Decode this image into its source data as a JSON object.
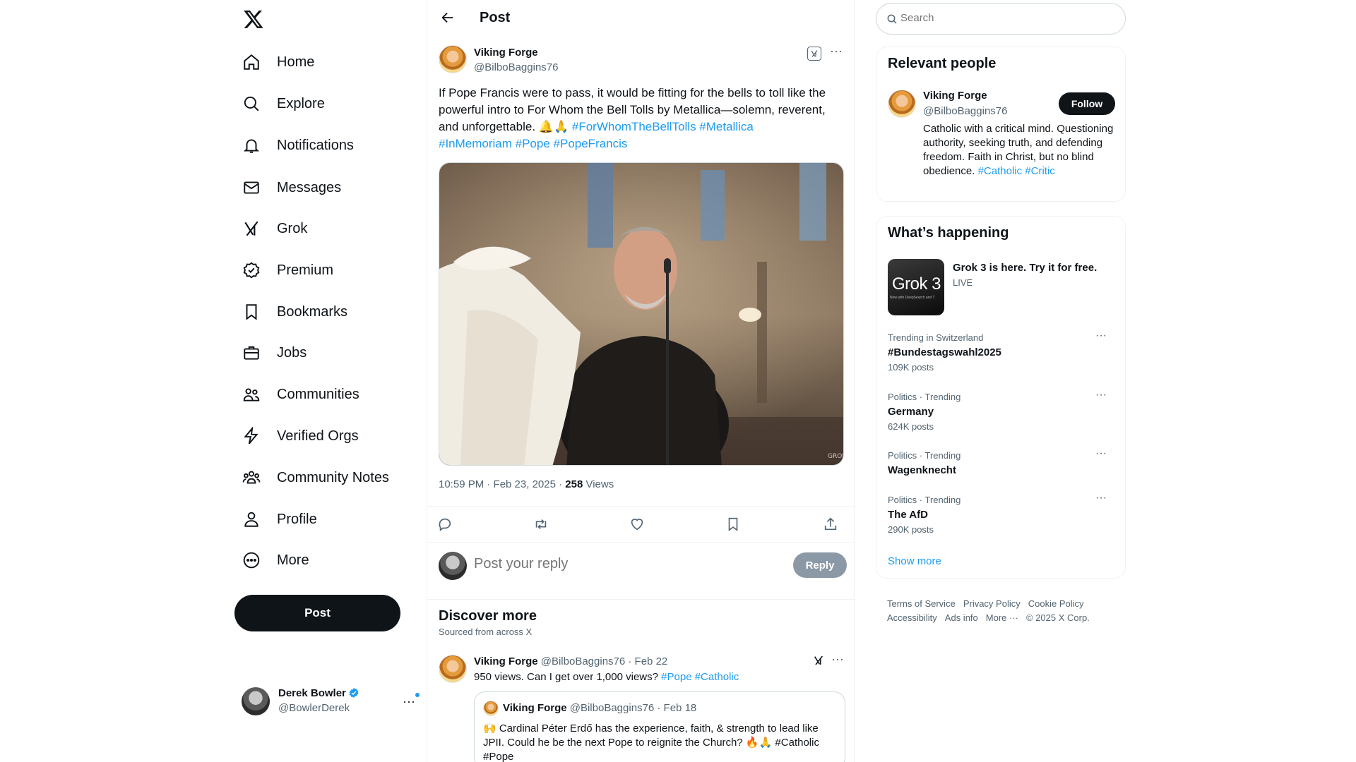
{
  "nav": {
    "items": [
      {
        "label": "Home",
        "icon": "home-icon"
      },
      {
        "label": "Explore",
        "icon": "search-icon"
      },
      {
        "label": "Notifications",
        "icon": "bell-icon"
      },
      {
        "label": "Messages",
        "icon": "envelope-icon"
      },
      {
        "label": "Grok",
        "icon": "grok-icon"
      },
      {
        "label": "Premium",
        "icon": "premium-icon"
      },
      {
        "label": "Bookmarks",
        "icon": "bookmark-icon"
      },
      {
        "label": "Jobs",
        "icon": "briefcase-icon"
      },
      {
        "label": "Communities",
        "icon": "communities-icon"
      },
      {
        "label": "Verified Orgs",
        "icon": "lightning-icon"
      },
      {
        "label": "Community Notes",
        "icon": "community-notes-icon"
      },
      {
        "label": "Profile",
        "icon": "person-icon"
      },
      {
        "label": "More",
        "icon": "more-circle-icon"
      }
    ],
    "post_label": "Post"
  },
  "me": {
    "name": "Derek Bowler",
    "handle": "@BowlerDerek"
  },
  "header": {
    "title": "Post"
  },
  "tweet": {
    "name": "Viking Forge",
    "handle": "@BilboBaggins76",
    "text": "If Pope Francis were to pass, it would be fitting for the bells to toll like the powerful intro to For Whom the Bell Tolls by Metallica—solemn, reverent, and unforgettable. 🔔🙏",
    "hashtags1": "#ForWhomTheBellTolls #Metallica",
    "hashtags2": "#InMemoriam #Pope #PopeFrancis",
    "time": "10:59 PM · Feb 23, 2025 · ",
    "views": "258",
    "views_label": " Views",
    "image_watermark": "GROK"
  },
  "reply": {
    "placeholder": "Post your reply",
    "button": "Reply"
  },
  "discover": {
    "title": "Discover more",
    "subtitle": "Sourced from across X",
    "post": {
      "name": "Viking Forge",
      "meta": " @BilboBaggins76 · Feb 22",
      "text": "950 views. Can I get over 1,000 views? ",
      "tags": "#Pope #Catholic"
    },
    "quote": {
      "name": "Viking Forge",
      "meta": " @BilboBaggins76 · Feb 18",
      "text": "🙌 Cardinal Péter Erdő has the experience, faith, & strength to lead like JPII. Could he be the next Pope to reignite the Church? 🔥🙏 #Catholic #Pope"
    }
  },
  "search": {
    "placeholder": "Search"
  },
  "relevant": {
    "title": "Relevant people",
    "name": "Viking Forge",
    "handle": "@BilboBaggins76",
    "follow": "Follow",
    "bio": "Catholic with a critical mind. Questioning authority, seeking truth, and defending freedom. Faith in Christ, but no blind obedience. ",
    "bio_tags": "#Catholic #Critic"
  },
  "happening": {
    "title": "What’s happening",
    "grok_thumb": "Grok 3",
    "grok_thumb_sub": "Now with DeepSearch and T",
    "grok_title": "Grok 3 is here. Try it for free.",
    "grok_live": "LIVE",
    "trends": [
      {
        "context": "Trending in Switzerland",
        "name": "#Bundestagswahl2025",
        "count": "109K posts"
      },
      {
        "context": "Politics · Trending",
        "name": "Germany",
        "count": "624K posts"
      },
      {
        "context": "Politics · Trending",
        "name": "Wagenknecht",
        "count": ""
      },
      {
        "context": "Politics · Trending",
        "name": "The AfD",
        "count": "290K posts"
      }
    ],
    "show_more": "Show more"
  },
  "footer": {
    "links": [
      "Terms of Service",
      "Privacy Policy",
      "Cookie Policy",
      "Accessibility",
      "Ads info",
      "More ···",
      "© 2025 X Corp."
    ]
  },
  "colors": {
    "accent": "#1d9bf0",
    "text": "#0f1419",
    "muted": "#536471"
  }
}
